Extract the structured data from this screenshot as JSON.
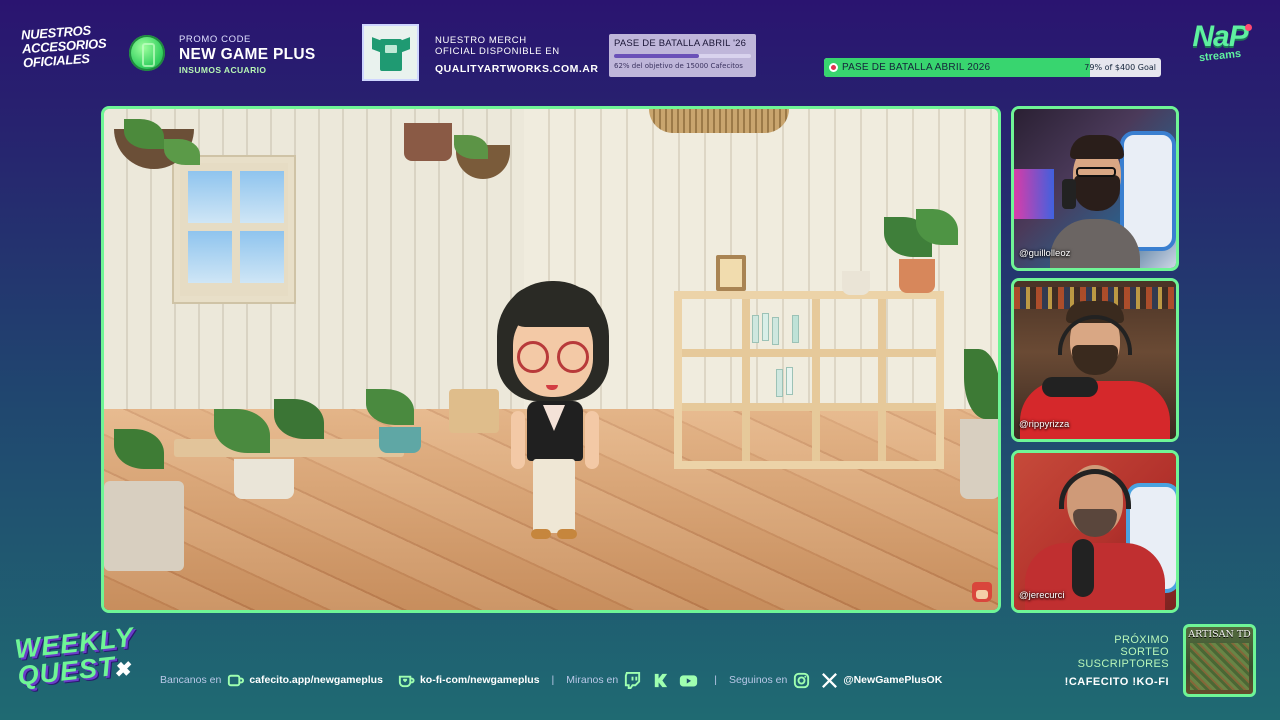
{
  "header": {
    "accesorios_logo": [
      "NUESTROS",
      "ACCESORIOS",
      "OFICIALES"
    ],
    "promo": {
      "label": "PROMO CODE",
      "code": "NEW GAME PLUS",
      "sub": "INSUMOS ACUARIO"
    },
    "merch": {
      "line1": "NUESTRO MERCH",
      "line2": "OFICIAL DISPONIBLE EN",
      "url": "QUALITYARTWORKS.COM.AR"
    },
    "battle_pass_card": {
      "title": "PASE DE BATALLA ABRIL '26",
      "progress": 0.62,
      "subtitle": "62% del objetivo de 15000 Cafecitos"
    },
    "goal_bar": {
      "title": "PASE DE BATALLA ABRIL 2026",
      "progress": 0.79,
      "value_text": "79% of $400 Goal"
    },
    "nap_logo": {
      "big": "NaP",
      "small": "streams"
    }
  },
  "webcams": [
    {
      "handle": "@guillolleoz"
    },
    {
      "handle": "@rippyrizza"
    },
    {
      "handle": "@jerecurci"
    }
  ],
  "footer": {
    "weekly_logo": [
      "WEEKLY",
      "QUEST"
    ],
    "weekly_x": "✖",
    "bancanos_label": "Bancanos en",
    "cafecito_link": "cafecito.app/newgameplus",
    "kofi_link": "ko-fi-com/newgameplus",
    "miranos_label": "Miranos en",
    "seguinos_label": "Seguinos en",
    "social_handle": "@NewGamePlusOK",
    "sorteo": [
      "PRÓXIMO",
      "SORTEO",
      "SUSCRIPTORES"
    ],
    "sorteo_commands": "!CAFECITO  !KO-FI",
    "artisan_title": "ARTISAN TD"
  },
  "colors": {
    "accent_green": "#6ff596",
    "goal_green": "#38d56f",
    "bg_top": "#2a1470",
    "bg_bottom": "#1f6a72"
  },
  "icons": [
    "cafecito-icon",
    "kofi-icon",
    "twitch-icon",
    "kick-icon",
    "youtube-icon",
    "instagram-icon",
    "x-icon"
  ]
}
